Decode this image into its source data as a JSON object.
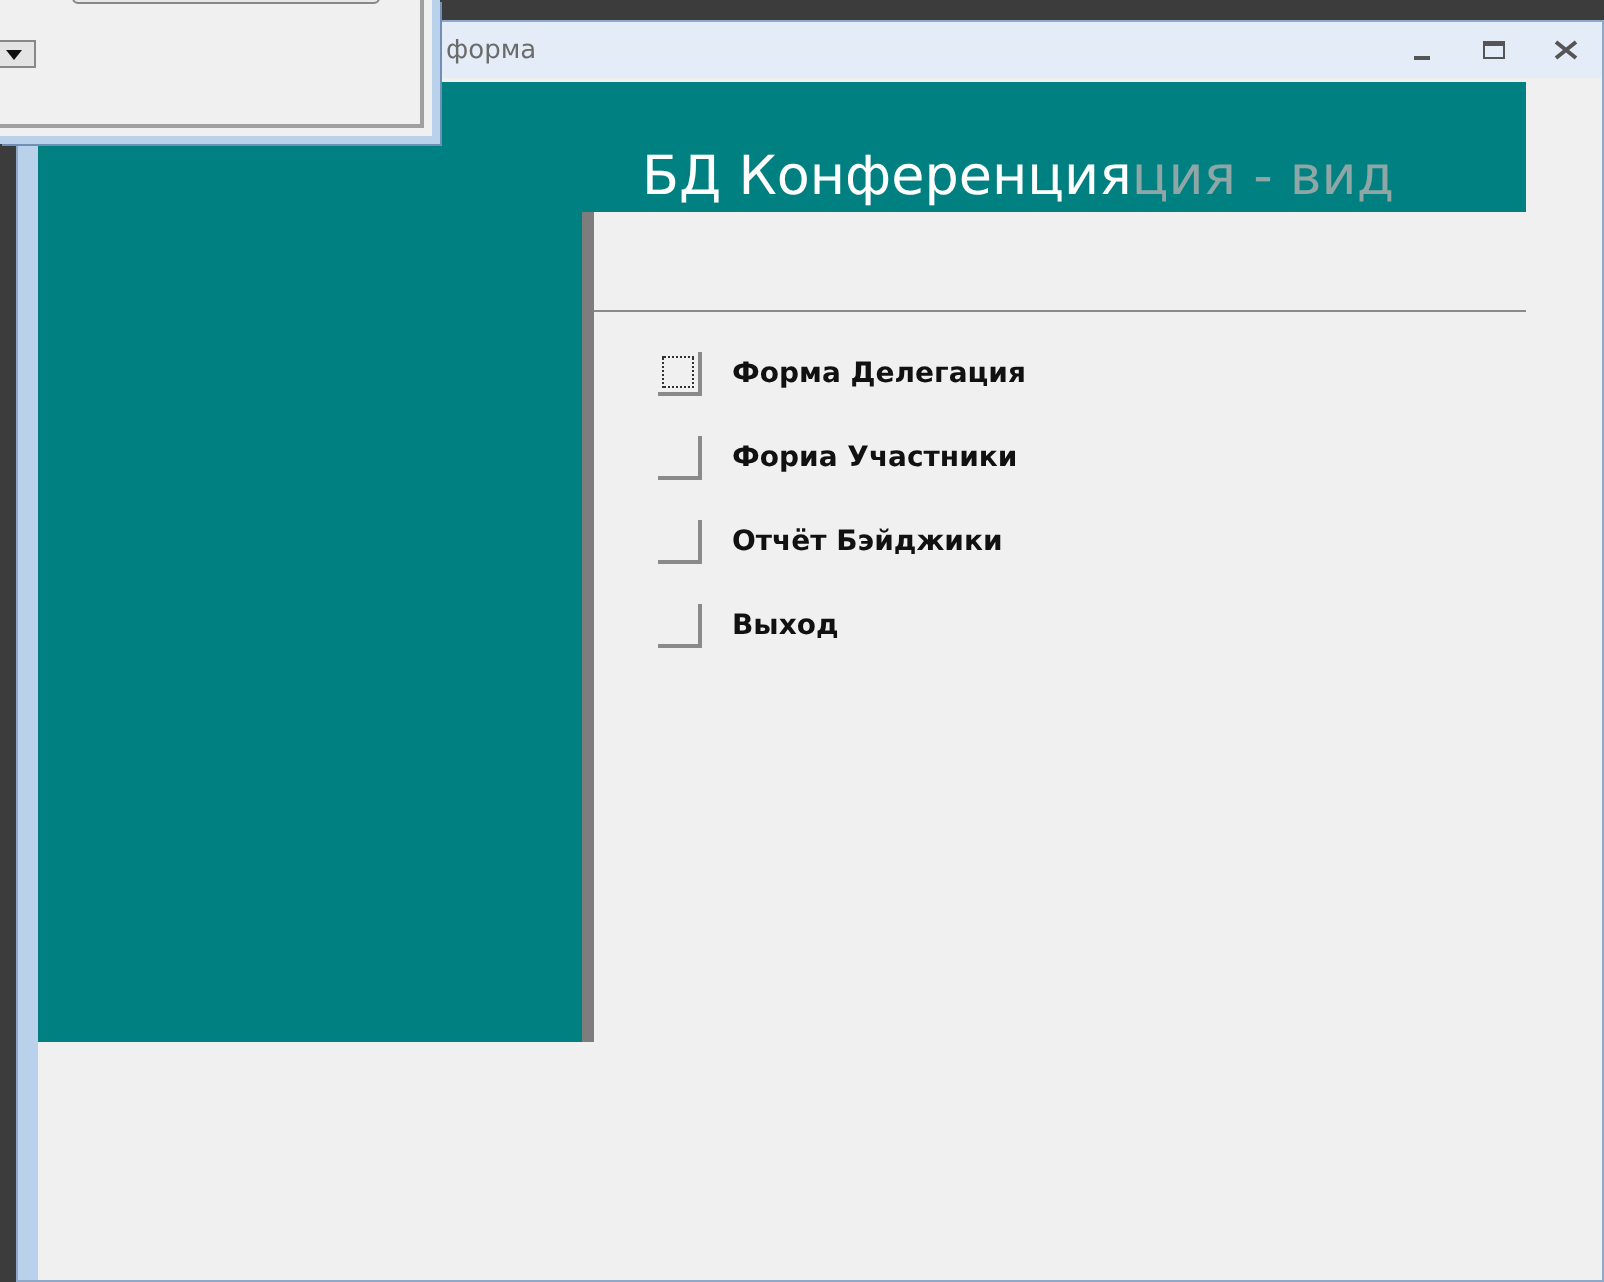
{
  "window": {
    "title": "форма"
  },
  "header": {
    "title": "БД Конференция",
    "ghost_text": "ция - вид"
  },
  "menu_buttons": [
    {
      "label": "Форма Делегация",
      "focused": true
    },
    {
      "label": "Фориа Участники",
      "focused": false
    },
    {
      "label": "Отчёт Бэйджики",
      "focused": false
    },
    {
      "label": "Выход",
      "focused": false
    }
  ]
}
